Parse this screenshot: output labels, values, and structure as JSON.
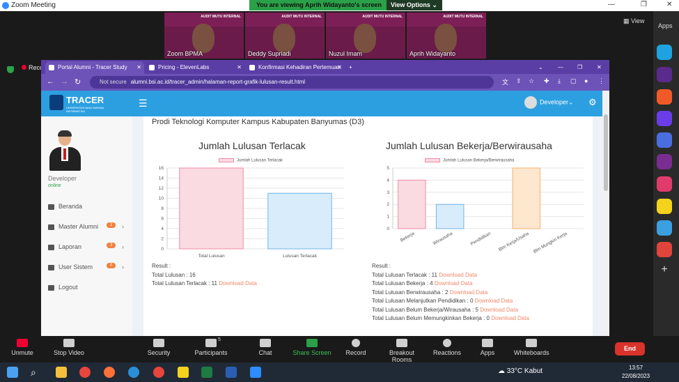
{
  "zoom": {
    "title": "Zoom Meeting",
    "share_banner": "You are viewing Aprih Widayanto's screen",
    "view_options": "View Options",
    "view_label": "View",
    "apps_label": "Apps",
    "recording": "Recording",
    "participants": [
      {
        "name": "Zoom BPMA",
        "banner": "AUDIT MUTU INTERNAL"
      },
      {
        "name": "Deddy Supriadi",
        "banner": "AUDIT MUTU INTERNAL"
      },
      {
        "name": "Nuzul Imam",
        "banner": "AUDIT MUTU INTERNAL"
      },
      {
        "name": "Aprih Widayanto",
        "banner": "AUDIT MUTU INTERNAL"
      }
    ],
    "toolbar": {
      "unmute": "Unmute",
      "stop_video": "Stop Video",
      "security": "Security",
      "participants": "Participants",
      "participants_count": "5",
      "chat": "Chat",
      "share_screen": "Share Screen",
      "record": "Record",
      "breakout": "Breakout Rooms",
      "reactions": "Reactions",
      "apps": "Apps",
      "whiteboards": "Whiteboards",
      "end": "End"
    }
  },
  "browser": {
    "tabs": [
      {
        "label": "Portal Alumni - Tracer Study"
      },
      {
        "label": "Pricing - ElevenLabs"
      },
      {
        "label": "Konfirmasi Kehadiran Pertemuan"
      }
    ],
    "not_secure": "Not secure",
    "url": "alumni.bsi.ac.id/tracer_admin/halaman-report-grafik-lulusan-result.html"
  },
  "app": {
    "brand": "TRACER",
    "brand_sub": "UNIVERSITAS BINA SARANA INFORMATIKA",
    "user": "Developer",
    "sidebar": {
      "name": "Developer",
      "status": "online",
      "menu": [
        {
          "label": "Beranda",
          "badge": null
        },
        {
          "label": "Master Alumni",
          "badge": "2"
        },
        {
          "label": "Laporan",
          "badge": "3"
        },
        {
          "label": "User Sistem",
          "badge": "0"
        },
        {
          "label": "Logout",
          "badge": null
        }
      ]
    },
    "page_title": "Prodi Teknologi Komputer Kampus Kabupaten Banyumas (D3)",
    "result_label": "Result :",
    "download_label": "Download Data",
    "results_left": [
      {
        "text": "Total Lulusan : 16",
        "download": false
      },
      {
        "text": "Total Lulusan Terlacak : 11",
        "download": true
      }
    ],
    "results_right": [
      {
        "text": "Total Lulusan Terlacak : 11",
        "download": true
      },
      {
        "text": "Total Lulusan Bekerja : 4",
        "download": true
      },
      {
        "text": "Total Lulusan Berwirausaha : 2",
        "download": true
      },
      {
        "text": "Total Lulusan Melanjutkan Pendidikan : 0",
        "download": true
      },
      {
        "text": "Total Lulusan Belum Bekerja/Wirausaha : 5",
        "download": true
      },
      {
        "text": "Total Lulusan Belum Memungkinkan Bekerja : 0",
        "download": true
      }
    ]
  },
  "chart_data": [
    {
      "type": "bar",
      "title": "Jumlah Lulusan Terlacak",
      "legend": "Jumlah Lulusan Terlacak",
      "categories": [
        "Total Lulusan",
        "Lulusan Terlacak"
      ],
      "values": [
        16,
        11
      ],
      "colors": [
        "#fadbe2",
        "#d9ecfb"
      ],
      "border_colors": [
        "#f28aa6",
        "#6fb4ea"
      ],
      "ylim": [
        0,
        16
      ],
      "yticks": [
        0,
        2,
        4,
        6,
        8,
        10,
        12,
        14,
        16
      ]
    },
    {
      "type": "bar",
      "title": "Jumlah Lulusan Bekerja/Berwirausaha",
      "legend": "Jumlah Lulusan Bekerja/Berwirausaha",
      "categories": [
        "Bekerja",
        "Wirausaha",
        "Pendidikan",
        "Blm Kerja/Usaha",
        "Blm Mungkin Kerja"
      ],
      "values": [
        4,
        2,
        0,
        5,
        0
      ],
      "colors": [
        "#fadbe2",
        "#d9ecfb",
        "#fff1d6",
        "#fde7cf",
        "#e6f3f3"
      ],
      "border_colors": [
        "#f28aa6",
        "#6fb4ea",
        "#f5c96c",
        "#f5b26b",
        "#7cc"
      ],
      "ylim": [
        0,
        5
      ],
      "yticks": [
        0,
        1,
        2,
        3,
        4,
        5
      ]
    }
  ],
  "taskbar": {
    "temp": "33°C",
    "weather": "Kabut",
    "time": "13:57",
    "date": "22/08/2023"
  }
}
